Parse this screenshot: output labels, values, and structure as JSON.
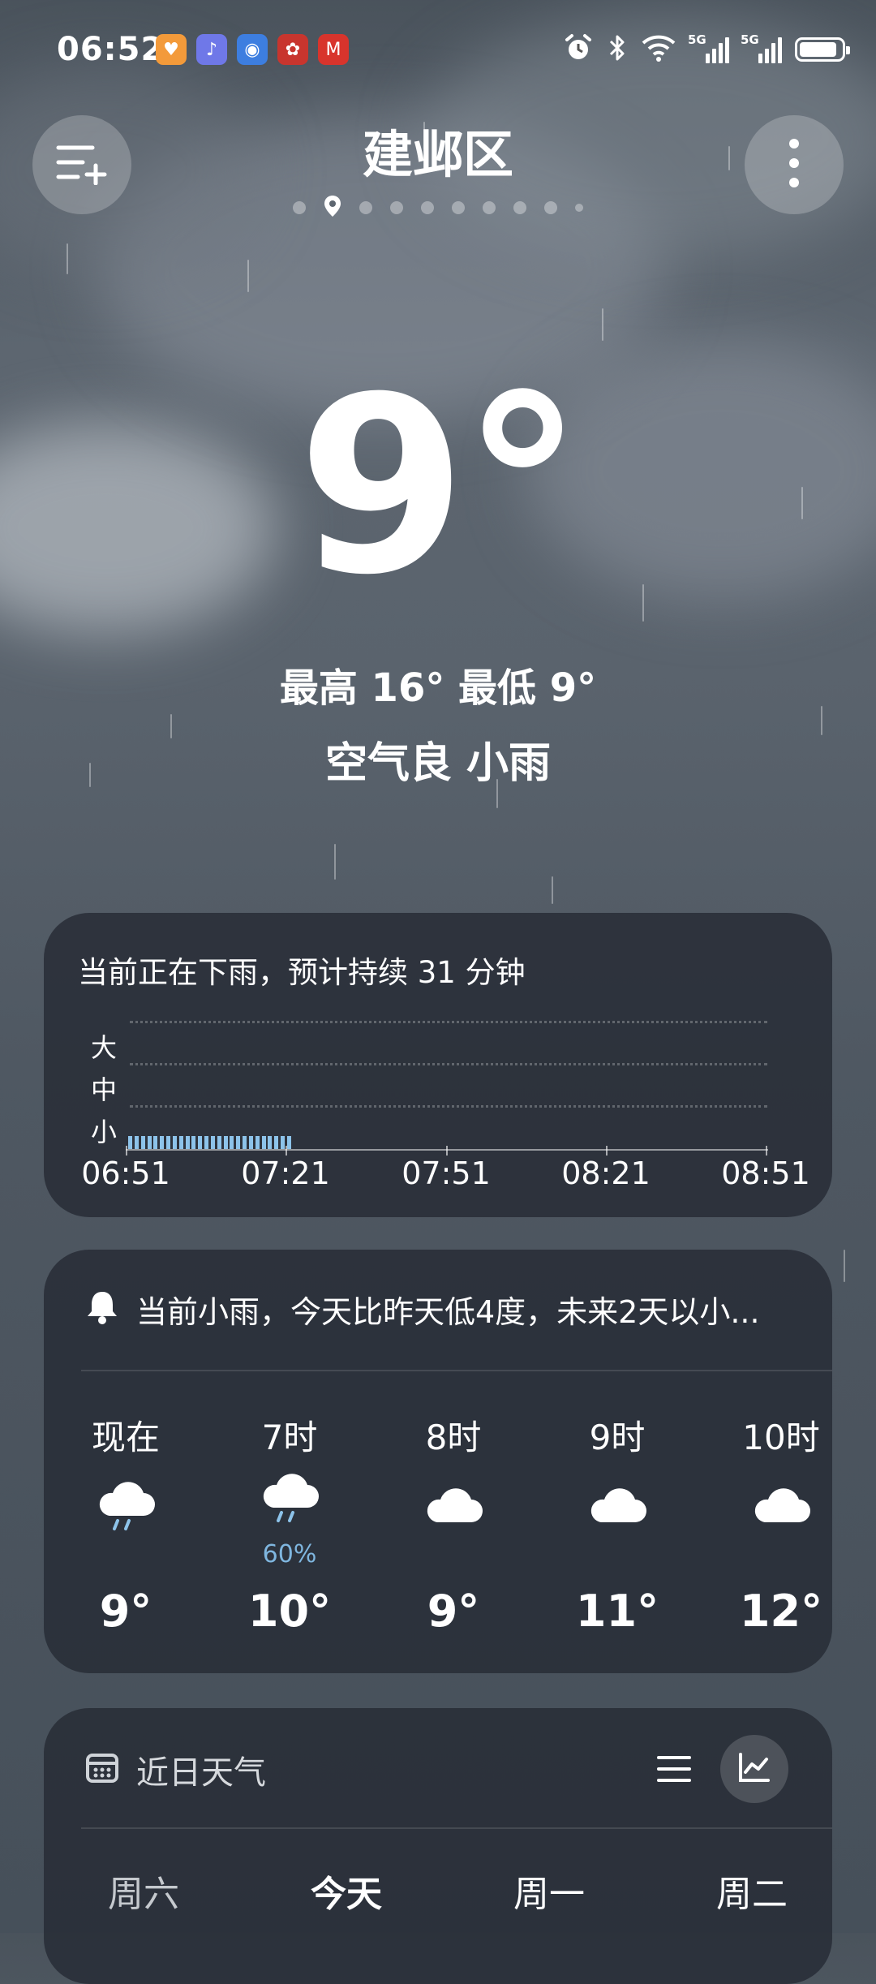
{
  "status_bar": {
    "time": "06:52",
    "network_1": "5G",
    "network_2": "5G",
    "battery_level": 0.9
  },
  "header": {
    "city": "建邺区",
    "page_count": 10,
    "current_page": 1
  },
  "current": {
    "temperature": "9°",
    "high_low": "最高 16° 最低 9°",
    "air_and_condition": "空气良  小雨"
  },
  "rain_forecast": {
    "title": "当前正在下雨，预计持续 31 分钟",
    "levels": [
      "大",
      "中",
      "小"
    ],
    "times": [
      "06:51",
      "07:21",
      "07:51",
      "08:21",
      "08:51"
    ],
    "intensity_minutes": 31,
    "intensity_level": "小"
  },
  "hourly": {
    "alert": "当前小雨，今天比昨天低4度，未来2天以小...",
    "items": [
      {
        "label": "现在",
        "icon": "rain-cloud-icon",
        "precip": "",
        "temp": "9°"
      },
      {
        "label": "7时",
        "icon": "rain-cloud-icon",
        "precip": "60%",
        "temp": "10°"
      },
      {
        "label": "8时",
        "icon": "cloud-icon",
        "precip": "",
        "temp": "9°"
      },
      {
        "label": "9时",
        "icon": "cloud-icon",
        "precip": "",
        "temp": "11°"
      },
      {
        "label": "10时",
        "icon": "cloud-icon",
        "precip": "",
        "temp": "12°"
      }
    ]
  },
  "daily": {
    "title": "近日天气",
    "days": [
      "周六",
      "今天",
      "周一",
      "周二"
    ]
  },
  "colors": {
    "card_bg": "#262b34",
    "rain_bar": "#8dc3ea",
    "precip_text": "#7fb6df"
  }
}
